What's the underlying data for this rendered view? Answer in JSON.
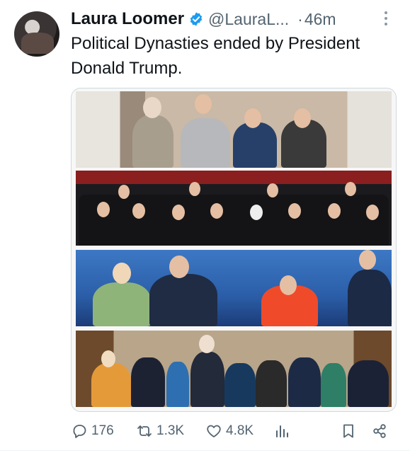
{
  "author": {
    "name": "Laura Loomer",
    "handle": "@LauraL...",
    "separator": "·",
    "time": "46m",
    "verified": true,
    "verified_color": "#1d9bf0"
  },
  "tweet": {
    "text": "Political Dynasties ended by President Donald Trump."
  },
  "media": {
    "panels": [
      "photo-clinton-family",
      "photo-bush-family",
      "photo-cheney-clinton-convention",
      "photo-biden-family"
    ]
  },
  "actions": {
    "replies": "176",
    "reposts": "1.3K",
    "likes": "4.8K"
  },
  "icons": [
    "more-icon",
    "verified-badge-icon",
    "reply-icon",
    "repost-icon",
    "like-icon",
    "views-icon",
    "bookmark-icon",
    "share-icon"
  ]
}
